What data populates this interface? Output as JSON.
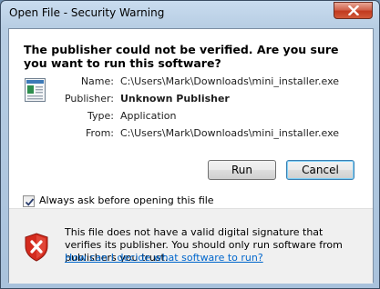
{
  "window": {
    "title": "Open File - Security Warning"
  },
  "dialog": {
    "heading": "The publisher could not be verified.  Are you sure you want to run this software?",
    "file_icon": "application-file-icon",
    "properties": [
      {
        "label": "Name:",
        "value": "C:\\Users\\Mark\\Downloads\\mini_installer.exe",
        "bold": false
      },
      {
        "label": "Publisher:",
        "value": "Unknown Publisher",
        "bold": true
      },
      {
        "label": "Type:",
        "value": "Application",
        "bold": false
      },
      {
        "label": "From:",
        "value": "C:\\Users\\Mark\\Downloads\\mini_installer.exe",
        "bold": false
      }
    ],
    "buttons": {
      "run": "Run",
      "cancel": "Cancel"
    },
    "checkbox": {
      "label": "Always ask before opening this file",
      "checked": true
    },
    "warning": {
      "icon": "error-shield-icon",
      "text": "This file does not have a valid digital signature that verifies its publisher.  You should only run software from publishers you trust.",
      "link": "How can I decide what software to run?"
    }
  },
  "colors": {
    "link": "#0066cc",
    "close_button": "#c13a1f",
    "error_red": "#d42b1e"
  }
}
